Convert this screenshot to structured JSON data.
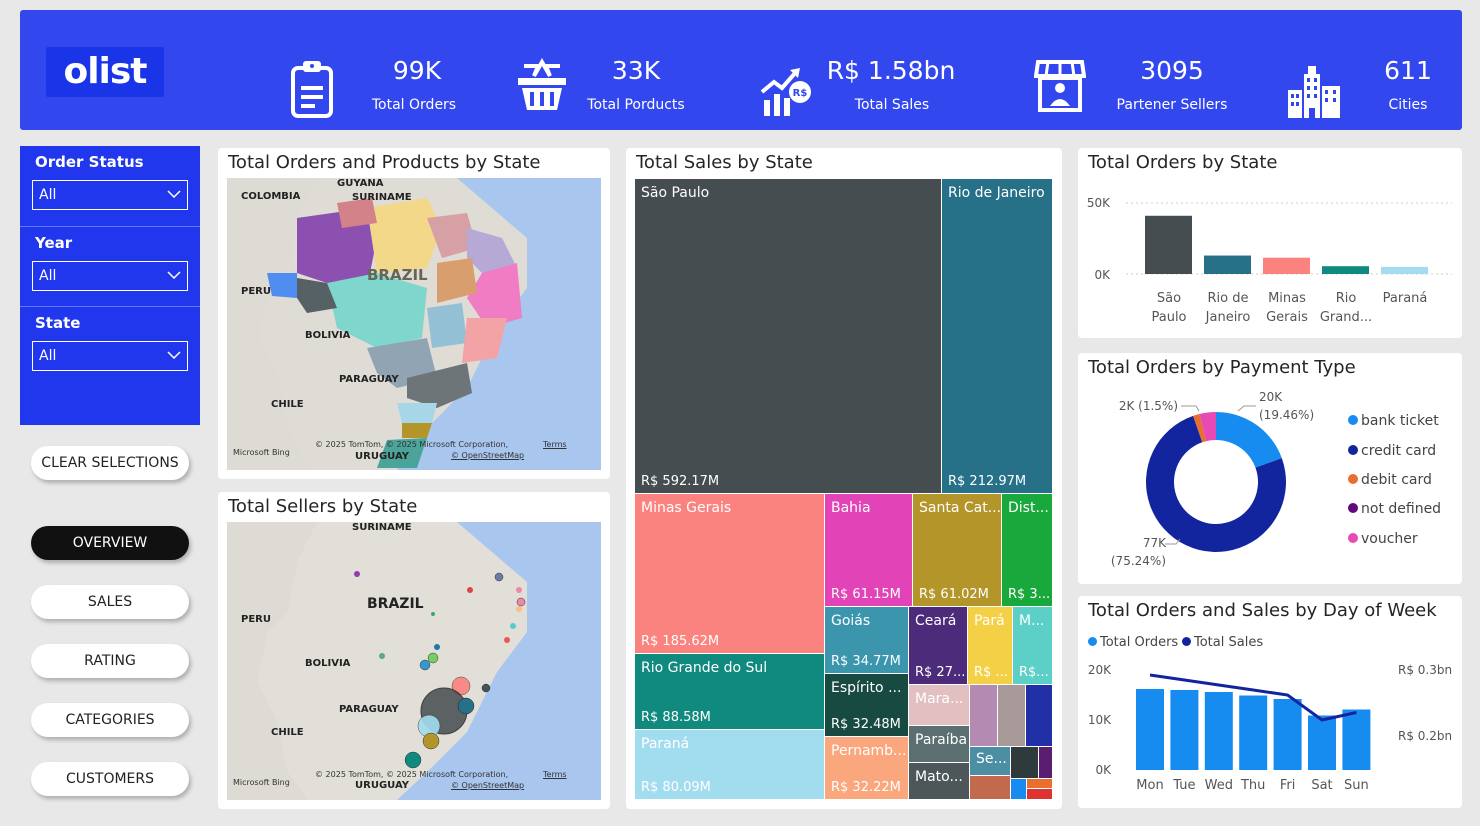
{
  "header": {
    "logo": "olist",
    "kpis": [
      {
        "value": "99K",
        "label": "Total Orders",
        "icon": "clipboard-icon"
      },
      {
        "value": "33K",
        "label": "Total Porducts",
        "icon": "basket-icon"
      },
      {
        "value": "R$ 1.58bn",
        "label": "Total Sales",
        "icon": "sales-growth-icon"
      },
      {
        "value": "3095",
        "label": "Partener Sellers",
        "icon": "storefront-icon"
      },
      {
        "value": "611",
        "label": "Cities",
        "icon": "city-icon"
      }
    ]
  },
  "filters": [
    {
      "title": "Order Status",
      "value": "All"
    },
    {
      "title": "Year",
      "value": "All"
    },
    {
      "title": "State",
      "value": "All"
    }
  ],
  "nav": {
    "clear": "CLEAR SELECTIONS",
    "items": [
      "OVERVIEW",
      "SALES",
      "RATING",
      "CATEGORIES",
      "CUSTOMERS"
    ],
    "active": "OVERVIEW"
  },
  "map1": {
    "title": "Total Orders and Products by State",
    "labels": {
      "guyana": "GUYANA",
      "colombia": "COLOMBIA",
      "suriname": "SURINAME",
      "brazil": "BRAZIL",
      "peru": "PERU",
      "bolivia": "BOLIVIA",
      "paraguay": "PARAGUAY",
      "chile": "CHILE",
      "uruguay": "URUGUAY"
    },
    "credit": "© 2025 TomTom, © 2025 Microsoft Corporation,",
    "terms": "Terms",
    "osm": "© OpenStreetMap",
    "bing": "Microsoft Bing"
  },
  "map2": {
    "title": "Total Sellers by State",
    "labels": {
      "suriname": "SURINAME",
      "brazil": "BRAZIL",
      "peru": "PERU",
      "bolivia": "BOLIVIA",
      "paraguay": "PARAGUAY",
      "chile": "CHILE",
      "uruguay": "URUGUAY"
    },
    "credit": "© 2025 TomTom, © 2025 Microsoft Corporation,",
    "terms": "Terms",
    "osm": "© OpenStreetMap",
    "bing": "Microsoft Bing"
  },
  "treemap": {
    "title": "Total Sales by State",
    "tiles": [
      {
        "name": "São Paulo",
        "value": "R$ 592.17M",
        "color": "#454d50"
      },
      {
        "name": "Rio de Janeiro",
        "value": "R$ 212.97M",
        "color": "#277188"
      },
      {
        "name": "Minas Gerais",
        "value": "R$ 185.62M",
        "color": "#fb837f"
      },
      {
        "name": "Bahia",
        "value": "R$ 61.15M",
        "color": "#e243b6"
      },
      {
        "name": "Santa Cat...",
        "value": "R$ 61.02M",
        "color": "#b3952a"
      },
      {
        "name": "Dist...",
        "value": "R$ 3...",
        "color": "#19a83c"
      },
      {
        "name": "Rio Grande do Sul",
        "value": "R$ 88.58M",
        "color": "#108a7f"
      },
      {
        "name": "Paraná",
        "value": "R$ 80.09M",
        "color": "#a2dcef"
      },
      {
        "name": "Goiás",
        "value": "R$ 34.77M",
        "color": "#3a95ad"
      },
      {
        "name": "Ceará",
        "value": "R$ 27...",
        "color": "#4c2b7a"
      },
      {
        "name": "Pará",
        "value": "R$ ...",
        "color": "#f3d045"
      },
      {
        "name": "M...",
        "value": "R$...",
        "color": "#5ccfc6"
      },
      {
        "name": "Espírito ...",
        "value": "R$ 32.48M",
        "color": "#174a40"
      },
      {
        "name": "Mara...",
        "value": "",
        "color": "#e2c0c2"
      },
      {
        "name": "Pernamb...",
        "value": "R$ 32.22M",
        "color": "#fba77d"
      },
      {
        "name": "Paraíba",
        "value": "",
        "color": "#5c6f70"
      },
      {
        "name": "Mato...",
        "value": "",
        "color": "#4d5759"
      },
      {
        "name": "Se...",
        "value": "",
        "color": "#4c8ea4"
      }
    ]
  },
  "orders_by_state": {
    "title": "Total Orders by State",
    "chart_data": {
      "type": "bar",
      "categories": [
        "São Paulo",
        "Rio de Janeiro",
        "Minas Gerais",
        "Rio Grand...",
        "Paraná"
      ],
      "values": [
        41000,
        13000,
        11500,
        5500,
        5000
      ],
      "colors": [
        "#454d50",
        "#277188",
        "#fb837f",
        "#108a7f",
        "#a2dcef"
      ],
      "yticks": [
        "50K",
        "0K"
      ],
      "ylim": [
        0,
        50000
      ]
    }
  },
  "payment": {
    "title": "Total Orders by Payment Type",
    "chart_data": {
      "type": "pie",
      "categories": [
        "bank ticket",
        "credit card",
        "debit card",
        "not defined",
        "voucher"
      ],
      "values": [
        19.46,
        75.24,
        1.5,
        0.01,
        3.79
      ],
      "colors": [
        "#168cf0",
        "#13259e",
        "#e86f2e",
        "#62087a",
        "#e84ab4"
      ],
      "labels": {
        "voucher_pct": "2K (1.5%)",
        "bank_val": "20K",
        "bank_pct": "(19.46%)",
        "credit_val": "77K",
        "credit_pct": "(75.24%)"
      }
    }
  },
  "dow": {
    "title": "Total Orders and Sales by Day of Week",
    "legend": [
      "Total Orders",
      "Total Sales"
    ],
    "colors": {
      "orders": "#168cf0",
      "sales": "#13259e"
    },
    "chart_data": {
      "type": "bar",
      "categories": [
        "Mon",
        "Tue",
        "Wed",
        "Thu",
        "Fri",
        "Sat",
        "Sun"
      ],
      "series": [
        {
          "name": "Total Orders",
          "values": [
            16200,
            16000,
            15600,
            14900,
            14200,
            10900,
            12100
          ]
        },
        {
          "name": "Total Sales",
          "values": [
            0.29,
            0.28,
            0.27,
            0.26,
            0.25,
            0.2,
            0.215
          ]
        }
      ],
      "y_left_ticks": [
        "20K",
        "10K",
        "0K"
      ],
      "y_right_ticks": [
        "R$ 0.3bn",
        "R$ 0.2bn"
      ],
      "ylim_left": [
        0,
        20000
      ]
    }
  }
}
